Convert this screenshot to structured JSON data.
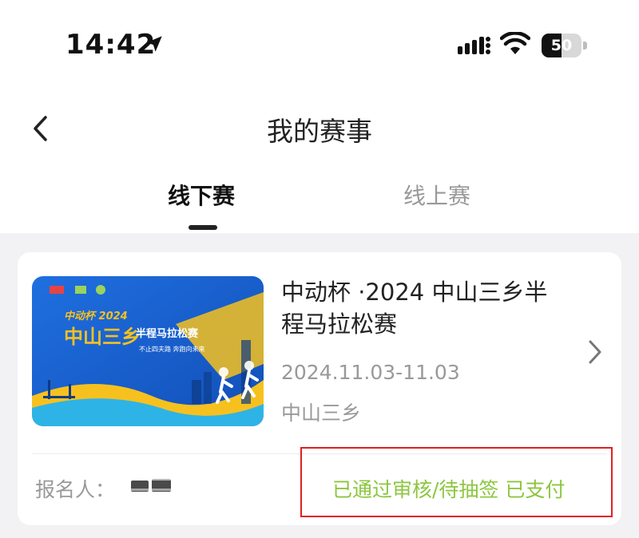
{
  "status_bar": {
    "time": "14:42",
    "battery_level": "50",
    "battery_fraction": 0.5
  },
  "nav": {
    "title": "我的赛事",
    "back_icon": "chevron-left-icon"
  },
  "tabs": [
    {
      "label": "线下赛",
      "active": true
    },
    {
      "label": "线上赛",
      "active": false
    }
  ],
  "event": {
    "title": "中动杯 ·2024 中山三乡半程马拉松赛",
    "date": "2024.11.03-11.03",
    "location": "中山三乡",
    "banner": {
      "brand_line": "中动杯 2024",
      "city": "中山三乡",
      "race": "半程马拉松赛",
      "slogan": "不止四夫路 奔跑向未来"
    },
    "registrant_label": "报名人：",
    "status": "已通过审核/待抽签 已支付",
    "status_color": "#8cc63f"
  },
  "colors": {
    "accent": "#8cc63f",
    "highlight_box": "#e12020",
    "banner_blue": "#1b64d0",
    "banner_yellow": "#f6c11f"
  }
}
